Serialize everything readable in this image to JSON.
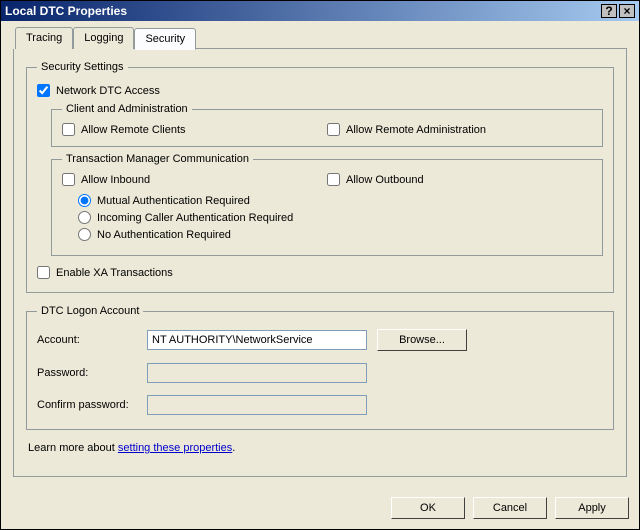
{
  "window": {
    "title": "Local DTC Properties"
  },
  "tabs": {
    "items": [
      {
        "label": "Tracing"
      },
      {
        "label": "Logging"
      },
      {
        "label": "Security"
      }
    ],
    "activeIndex": 2
  },
  "security": {
    "group_label": "Security Settings",
    "network_dtc_label": "Network DTC Access",
    "network_dtc_checked": true,
    "client_admin": {
      "group_label": "Client and Administration",
      "allow_remote_clients": {
        "label": "Allow Remote Clients",
        "checked": false
      },
      "allow_remote_admin": {
        "label": "Allow Remote Administration",
        "checked": false
      }
    },
    "tm_comm": {
      "group_label": "Transaction Manager Communication",
      "allow_inbound": {
        "label": "Allow Inbound",
        "checked": false
      },
      "allow_outbound": {
        "label": "Allow Outbound",
        "checked": false
      },
      "auth_mode": "mutual",
      "radio_mutual": "Mutual Authentication Required",
      "radio_incoming": "Incoming Caller Authentication Required",
      "radio_none": "No Authentication Required"
    },
    "enable_xa": {
      "label": "Enable XA Transactions",
      "checked": false
    }
  },
  "logon": {
    "group_label": "DTC Logon Account",
    "account_label": "Account:",
    "account_value": "NT AUTHORITY\\NetworkService",
    "browse_label": "Browse...",
    "password_label": "Password:",
    "confirm_label": "Confirm password:"
  },
  "learn": {
    "prefix": "Learn more about ",
    "link_text": "setting these properties",
    "suffix": "."
  },
  "buttons": {
    "ok": "OK",
    "cancel": "Cancel",
    "apply": "Apply"
  }
}
